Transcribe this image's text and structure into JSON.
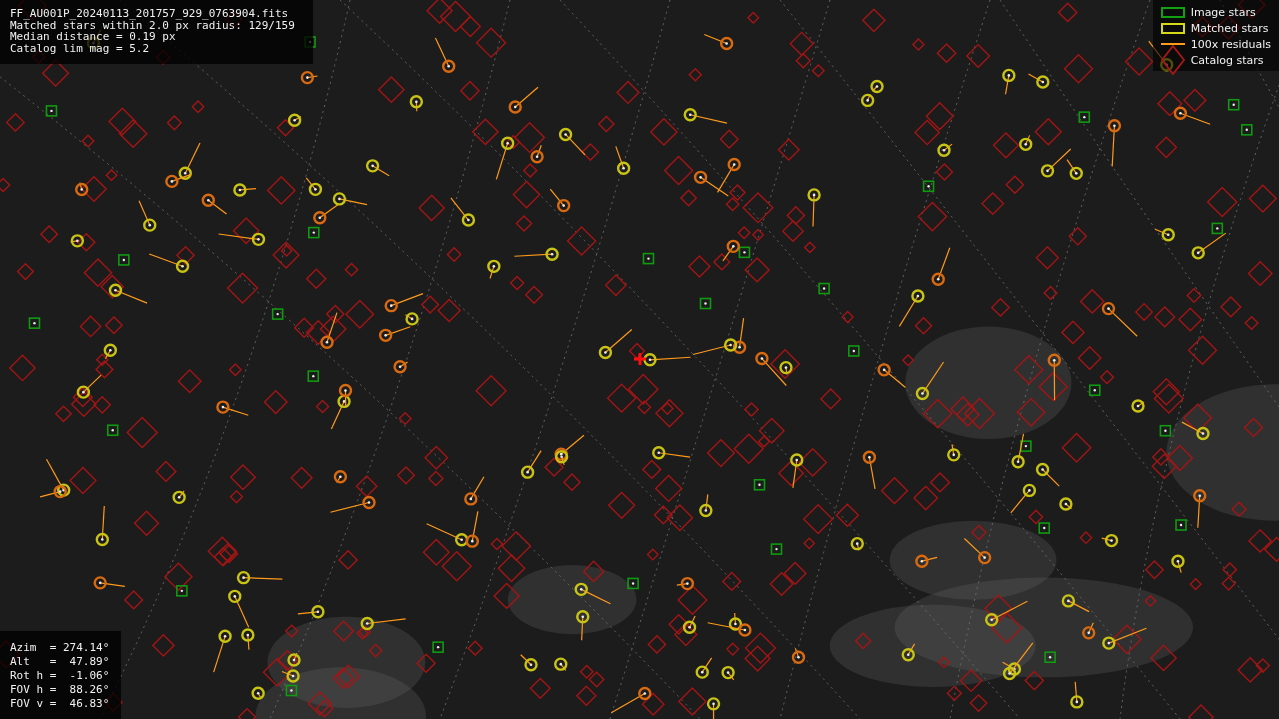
{
  "info": {
    "lines": [
      "FF_AU001P_20240113_201757_929_0763904.fits",
      "Matched stars within 2.0 px radius: 129/159",
      "Median distance = 0.19 px",
      "Catalog lim mag = 5.2"
    ]
  },
  "legend": [
    {
      "kind": "image",
      "label": "Image stars"
    },
    {
      "kind": "matched",
      "label": "Matched stars"
    },
    {
      "kind": "residual",
      "label": "100x residuals"
    },
    {
      "kind": "catalog",
      "label": "Catalog stars"
    }
  ],
  "pointing": {
    "lines": [
      "Azim  = 274.14°",
      "Alt   =  47.89°",
      "Rot h =  -1.06°",
      "FOV h =  88.26°",
      "FOV v =  46.83°"
    ]
  }
}
